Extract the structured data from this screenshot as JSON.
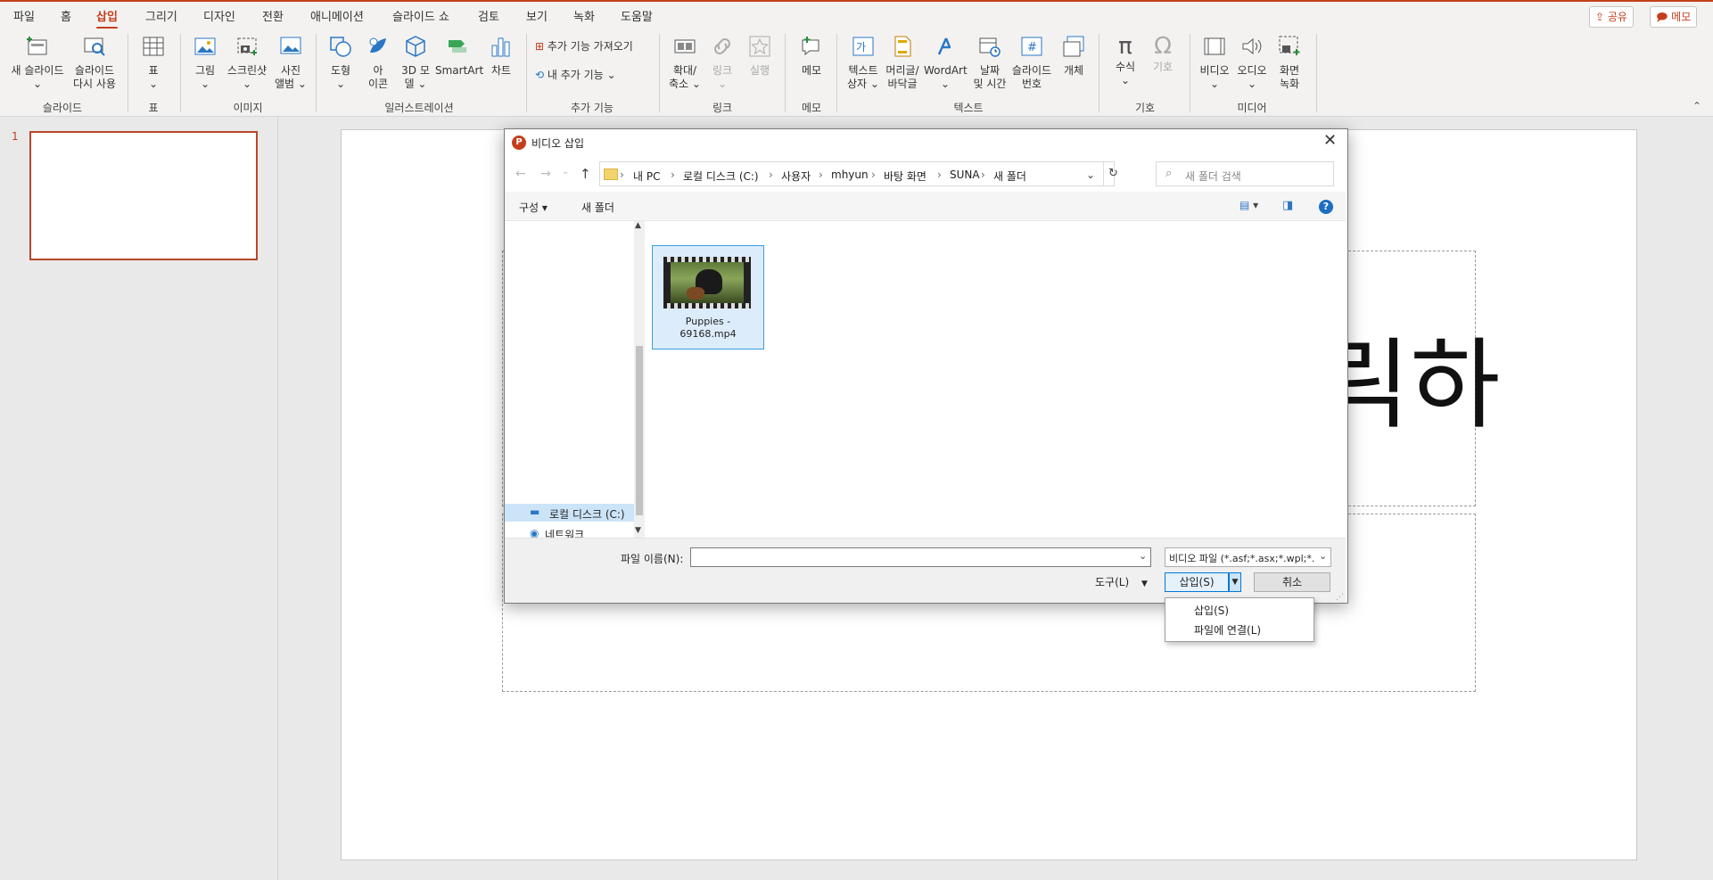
{
  "menu": {
    "tabs": [
      "파일",
      "홈",
      "삽입",
      "그리기",
      "디자인",
      "전환",
      "애니메이션",
      "슬라이드 쇼",
      "검토",
      "보기",
      "녹화",
      "도움말"
    ],
    "active_tab": "삽입",
    "share_label": "공유",
    "comment_label": "메모"
  },
  "ribbon": {
    "new_slide": "새 슬라이드",
    "reuse_slide_1": "슬라이드",
    "reuse_slide_2": "다시 사용",
    "table": "표",
    "picture": "그림",
    "screenshot": "스크린샷",
    "album_1": "사진",
    "album_2": "앨범",
    "shapes": "도형",
    "icons_1": "아",
    "icons_2": "이콘",
    "model3d_1": "3D 모",
    "model3d_2": "델",
    "smartart": "SmartArt",
    "chart": "차트",
    "get_addins": "추가 기능 가져오기",
    "my_addins": "내 추가 기능",
    "zoom_1": "확대/",
    "zoom_2": "축소",
    "link": "링크",
    "action": "실행",
    "comment": "메모",
    "textbox_1": "텍스트",
    "textbox_2": "상자",
    "header_1": "머리글/",
    "header_2": "바닥글",
    "wordart": "WordArt",
    "datetime_1": "날짜",
    "datetime_2": "및 시간",
    "slidenum_1": "슬라이드",
    "slidenum_2": "번호",
    "object": "개체",
    "equation": "수식",
    "symbol": "기호",
    "video": "비디오",
    "audio": "오디오",
    "screenrec_1": "화면",
    "screenrec_2": "녹화",
    "groups": {
      "slides": "슬라이드",
      "tables": "표",
      "images": "이미지",
      "illustrations": "일러스트레이션",
      "addins": "추가 기능",
      "links": "링크",
      "comments": "메모",
      "text": "텍스트",
      "symbols": "기호",
      "media": "미디어"
    }
  },
  "slide_panel": {
    "number": "1"
  },
  "slide": {
    "title_partial": "릭하"
  },
  "dialog": {
    "title": "비디오 삽입",
    "breadcrumb": [
      "내 PC",
      "로컬 디스크 (C:)",
      "사용자",
      "mhyun",
      "바탕 화면",
      "SUNA",
      "새 폴더"
    ],
    "search_placeholder": "새 폴더 검색",
    "organize": "구성",
    "new_folder": "새 폴더",
    "nav_item_1": "로컬 디스크 (C:)",
    "nav_item_2": "네트워크",
    "file_name_1": "Puppies -",
    "file_name_2": "69168.mp4",
    "filename_label": "파일 이름(N):",
    "filename_value": "",
    "filetype": "비디오 파일 (*.asf;*.asx;*.wpl;*.",
    "tools": "도구(L)",
    "insert": "삽입(S)",
    "cancel": "취소",
    "menu_insert": "삽입(S)",
    "menu_link": "파일에 연결(L)"
  }
}
